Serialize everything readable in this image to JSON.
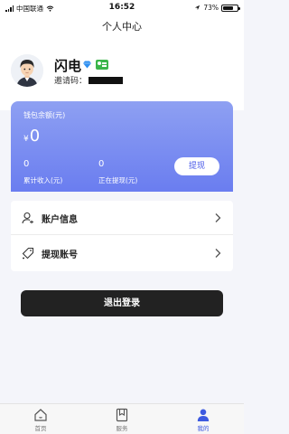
{
  "status_bar": {
    "carrier": "中国联通",
    "time": "16:52",
    "battery_text": "73%",
    "battery_level": 0.73
  },
  "nav": {
    "title": "个人中心"
  },
  "profile": {
    "name": "闪电",
    "invite_label": "邀请码："
  },
  "wallet": {
    "label": "钱包余额(元)",
    "currency": "¥",
    "balance": "0",
    "income_value": "0",
    "income_label": "累计收入(元)",
    "pending_value": "0",
    "pending_label": "正在提现(元)",
    "withdraw_label": "提现"
  },
  "menu": {
    "items": [
      {
        "label": "账户信息",
        "icon": "user-icon"
      },
      {
        "label": "提现账号",
        "icon": "tag-icon"
      }
    ]
  },
  "logout_label": "退出登录",
  "tabs": [
    {
      "label": "首页",
      "icon": "home-icon"
    },
    {
      "label": "服务",
      "icon": "bookmark-icon"
    },
    {
      "label": "我的",
      "icon": "person-icon",
      "active": true
    }
  ],
  "colors": {
    "accent": "#3d5ae0",
    "wallet_gradient_top": "#8ea0f2",
    "wallet_gradient_bottom": "#6a7df0",
    "logout_bg": "#222222"
  }
}
